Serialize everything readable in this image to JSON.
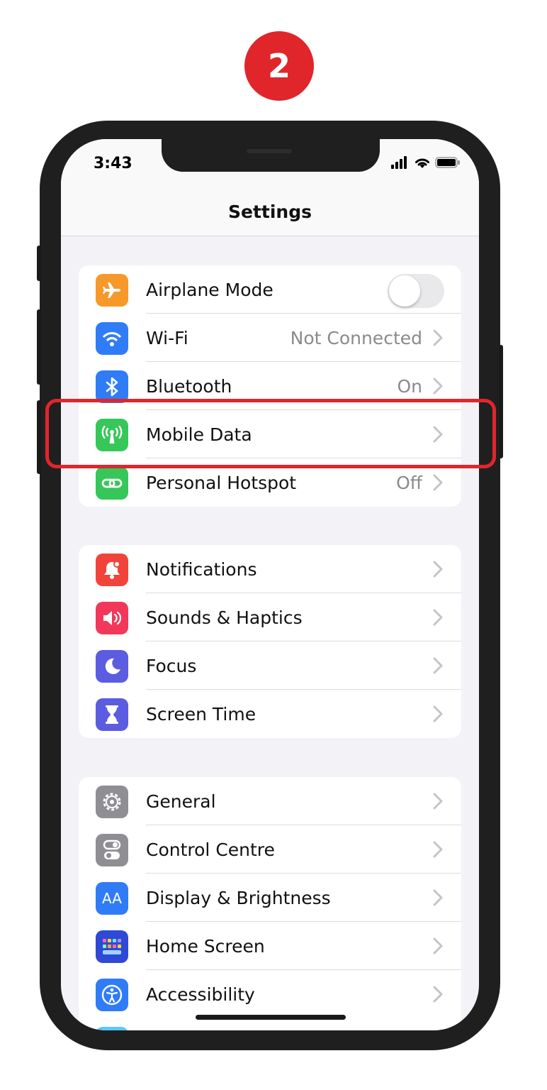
{
  "step_number": "2",
  "status_bar": {
    "time": "3:43"
  },
  "navbar": {
    "title": "Settings"
  },
  "groups": [
    {
      "rows": [
        {
          "label": "Airplane Mode",
          "icon": "airplane-icon",
          "color": "#f7982a",
          "toggle": "off"
        },
        {
          "label": "Wi-Fi",
          "detail": "Not Connected",
          "icon": "wifi-icon",
          "color": "#2f7cf6"
        },
        {
          "label": "Bluetooth",
          "detail": "On",
          "icon": "bluetooth-icon",
          "color": "#2f7cf6"
        },
        {
          "label": "Mobile Data",
          "detail": "",
          "icon": "antenna-icon",
          "color": "#36c759"
        },
        {
          "label": "Personal Hotspot",
          "detail": "Off",
          "icon": "hotspot-icon",
          "color": "#36c759"
        }
      ]
    },
    {
      "rows": [
        {
          "label": "Notifications",
          "icon": "bell-icon",
          "color": "#f2433a"
        },
        {
          "label": "Sounds & Haptics",
          "icon": "speaker-icon",
          "color": "#f2385a"
        },
        {
          "label": "Focus",
          "icon": "moon-icon",
          "color": "#5b5ce0"
        },
        {
          "label": "Screen Time",
          "icon": "hourglass-icon",
          "color": "#5b5ce0"
        }
      ]
    },
    {
      "rows": [
        {
          "label": "General",
          "icon": "gear-icon",
          "color": "#8e8e93"
        },
        {
          "label": "Control Centre",
          "icon": "switches-icon",
          "color": "#8e8e93"
        },
        {
          "label": "Display & Brightness",
          "icon": "text-size-icon",
          "color": "#2f7cf6",
          "icon_text": "AA"
        },
        {
          "label": "Home Screen",
          "icon": "app-grid-icon",
          "color": "#2d49d6"
        },
        {
          "label": "Accessibility",
          "icon": "accessibility-icon",
          "color": "#2f7cf6"
        }
      ]
    }
  ],
  "highlighted_row": "Mobile Data",
  "colors": {
    "accent_red": "#e0262b",
    "background": "#f2f2f7"
  }
}
